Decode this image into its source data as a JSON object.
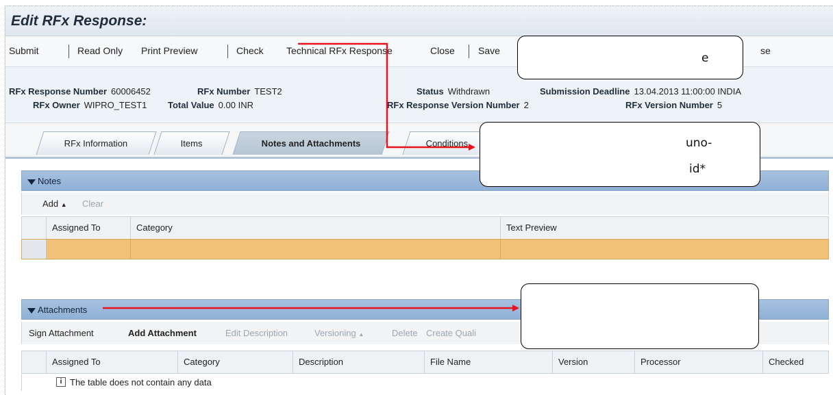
{
  "title": "Edit RFx Response:",
  "toolbar": {
    "submit": "Submit",
    "read_only": "Read Only",
    "print_preview": "Print Preview",
    "check": "Check",
    "technical": "Technical RFx Response",
    "close": "Close",
    "save": "Save",
    "trailing_fragment": "se"
  },
  "header": {
    "rfx_response_number_label": "RFx Response Number",
    "rfx_response_number": "60006452",
    "rfx_number_label": "RFx Number",
    "rfx_number": "TEST2",
    "status_label": "Status",
    "status": "Withdrawn",
    "deadline_label": "Submission Deadline",
    "deadline": "13.04.2013 11:00:00 INDIA",
    "owner_label": "RFx Owner",
    "owner": "WIPRO_TEST1",
    "total_value_label": "Total Value",
    "total_value": "0.00 INR",
    "response_version_label": "RFx Response Version Number",
    "response_version": "2",
    "rfx_version_label": "RFx Version Number",
    "rfx_version": "5"
  },
  "tabs": {
    "rfx_information": "RFx Information",
    "items": "Items",
    "notes_attachments": "Notes and Attachments",
    "conditions": "Conditions"
  },
  "notes": {
    "title": "Notes",
    "add": "Add",
    "clear": "Clear",
    "columns": [
      "Assigned To",
      "Category",
      "Text Preview"
    ]
  },
  "attachments": {
    "title": "Attachments",
    "actions": [
      "Sign Attachment",
      "Add Attachment",
      "Edit Description",
      "Versioning",
      "Delete",
      "Create Quali"
    ],
    "columns": [
      "Assigned To",
      "Category",
      "Description",
      "File Name",
      "Version",
      "Processor",
      "Checked"
    ],
    "empty_message": "The table does not contain any data"
  },
  "callouts": {
    "c1": "e",
    "c2_line1": "uno-",
    "c2_line2": "id*"
  },
  "colors": {
    "arrow": "#e8141c",
    "section_bar": "#9ab7da",
    "selected_row": "#f1c276"
  }
}
